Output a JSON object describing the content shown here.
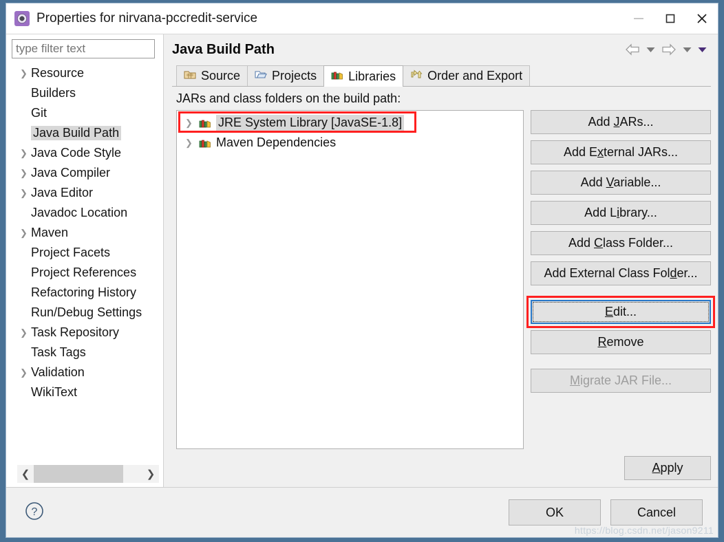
{
  "window": {
    "title": "Properties for nirvana-pccredit-service",
    "icon": "eclipse-properties-icon",
    "controls": {
      "minimize": "minimize-icon",
      "maximize": "maximize-icon",
      "close": "close-icon"
    }
  },
  "sidebar": {
    "filter": {
      "placeholder": "type filter text",
      "value": ""
    },
    "items": [
      {
        "label": "Resource",
        "expandable": true,
        "selected": false
      },
      {
        "label": "Builders",
        "expandable": false,
        "selected": false
      },
      {
        "label": "Git",
        "expandable": false,
        "selected": false
      },
      {
        "label": "Java Build Path",
        "expandable": false,
        "selected": true
      },
      {
        "label": "Java Code Style",
        "expandable": true,
        "selected": false
      },
      {
        "label": "Java Compiler",
        "expandable": true,
        "selected": false
      },
      {
        "label": "Java Editor",
        "expandable": true,
        "selected": false
      },
      {
        "label": "Javadoc Location",
        "expandable": false,
        "selected": false
      },
      {
        "label": "Maven",
        "expandable": true,
        "selected": false
      },
      {
        "label": "Project Facets",
        "expandable": false,
        "selected": false
      },
      {
        "label": "Project References",
        "expandable": false,
        "selected": false
      },
      {
        "label": "Refactoring History",
        "expandable": false,
        "selected": false
      },
      {
        "label": "Run/Debug Settings",
        "expandable": false,
        "selected": false
      },
      {
        "label": "Task Repository",
        "expandable": true,
        "selected": false
      },
      {
        "label": "Task Tags",
        "expandable": false,
        "selected": false
      },
      {
        "label": "Validation",
        "expandable": true,
        "selected": false
      },
      {
        "label": "WikiText",
        "expandable": false,
        "selected": false
      }
    ]
  },
  "page": {
    "title": "Java Build Path",
    "nav": [
      "back-arrow-icon",
      "back-dropdown-icon",
      "forward-arrow-icon",
      "forward-dropdown-icon",
      "view-menu-icon"
    ]
  },
  "tabs": [
    {
      "label": "Source",
      "icon": "source-folder-icon",
      "active": false
    },
    {
      "label": "Projects",
      "icon": "projects-folder-icon",
      "active": false
    },
    {
      "label": "Libraries",
      "icon": "libraries-books-icon",
      "active": true
    },
    {
      "label": "Order and Export",
      "icon": "order-export-icon",
      "active": false
    }
  ],
  "libraries_panel": {
    "label": "JARs and class folders on the build path:",
    "entries": [
      {
        "label": "JRE System Library [JavaSE-1.8]",
        "icon": "library-books-icon",
        "selected": true,
        "expandable": true
      },
      {
        "label": "Maven Dependencies",
        "icon": "library-books-icon",
        "selected": false,
        "expandable": true
      }
    ],
    "buttons": [
      {
        "label": "Add JARs...",
        "mnemonic": "J",
        "state": "enabled"
      },
      {
        "label": "Add External JARs...",
        "mnemonic": "x",
        "state": "enabled"
      },
      {
        "label": "Add Variable...",
        "mnemonic": "V",
        "state": "enabled"
      },
      {
        "label": "Add Library...",
        "mnemonic": "i",
        "state": "enabled"
      },
      {
        "label": "Add Class Folder...",
        "mnemonic": "C",
        "state": "enabled"
      },
      {
        "label": "Add External Class Folder...",
        "mnemonic": "d",
        "state": "enabled"
      },
      {
        "label": "Edit...",
        "mnemonic": "E",
        "state": "focused"
      },
      {
        "label": "Remove",
        "mnemonic": "R",
        "state": "enabled"
      },
      {
        "label": "Migrate JAR File...",
        "mnemonic": "M",
        "state": "disabled"
      }
    ]
  },
  "apply_button": {
    "label": "Apply",
    "mnemonic": "A"
  },
  "footer": {
    "help_icon": "help-question-icon",
    "ok_label": "OK",
    "cancel_label": "Cancel"
  },
  "watermark": "https://blog.csdn.net/jason9211",
  "annotations": {
    "highlight_color": "#ff2020",
    "focus_color": "#2878c8",
    "selection_color": "#d8d8d8"
  }
}
